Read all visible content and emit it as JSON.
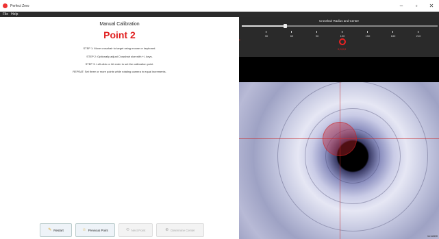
{
  "window": {
    "title": "Perfect Zero",
    "minimize": "–",
    "maximize": "▫",
    "close": "✕"
  },
  "menu": [
    "File",
    "Help"
  ],
  "calibration": {
    "title": "Manual Calibration",
    "point_label": "Point 2",
    "steps": [
      "STEP 1: Move crosshair to target using mouse or keyboard.",
      "STEP 2: Optionally adjust Crosshair size with +/- keys.",
      "STEP 3: Left-click or hit enter to set the calibration point.",
      "REPEAT: Set three or more points while rotating camera in equal increments."
    ]
  },
  "buttons": {
    "restart": "Restart",
    "previous": "Previous Point",
    "next": "Next Point",
    "determine": "Determine Center"
  },
  "ruler": {
    "title": "Crosshair Radius and Center",
    "slider_fraction": 0.22,
    "ticks": [
      "30",
      "60",
      "90",
      "120",
      "150",
      "180",
      "210"
    ],
    "marker_value": "120",
    "marker_label": "0,0,0,0"
  },
  "camera": {
    "corner_text": "1x1x600"
  },
  "colors": {
    "accent_red": "#e02020",
    "menubar": "#2b2b2b"
  }
}
